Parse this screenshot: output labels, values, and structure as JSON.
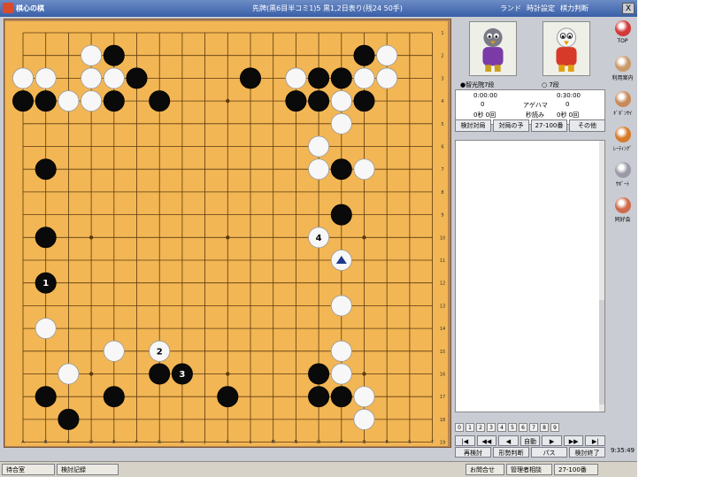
{
  "window": {
    "title": "棋心の棋",
    "game_info": "先牌(黒6目半コミ1)5 黒1,2日表り(残24 50手)",
    "menu": [
      "ランド",
      "時計設定",
      "棋力判断"
    ],
    "close": "X"
  },
  "board": {
    "size": 19,
    "col_labels": [
      "A",
      "B",
      "C",
      "D",
      "E",
      "F",
      "G",
      "H",
      "J",
      "K",
      "L",
      "M",
      "N",
      "O",
      "P",
      "Q",
      "R",
      "S",
      "T"
    ],
    "row_labels": [
      "1",
      "2",
      "3",
      "4",
      "5",
      "6",
      "7",
      "8",
      "9",
      "10",
      "11",
      "12",
      "13",
      "14",
      "15",
      "16",
      "17",
      "18",
      "19"
    ],
    "colors": {
      "wood": "#f2b654",
      "line": "#5c3a10",
      "black_stone": "#0a0a0a",
      "white_stone": "#f7f7f7",
      "marker": "#1d3a8a"
    },
    "stones": [
      {
        "c": "W",
        "col": 4,
        "row": 2
      },
      {
        "c": "B",
        "col": 5,
        "row": 2
      },
      {
        "c": "W",
        "col": 1,
        "row": 3
      },
      {
        "c": "W",
        "col": 2,
        "row": 3
      },
      {
        "c": "W",
        "col": 4,
        "row": 3
      },
      {
        "c": "W",
        "col": 5,
        "row": 3
      },
      {
        "c": "B",
        "col": 6,
        "row": 3
      },
      {
        "c": "B",
        "col": 11,
        "row": 3
      },
      {
        "c": "B",
        "col": 1,
        "row": 4
      },
      {
        "c": "B",
        "col": 2,
        "row": 4
      },
      {
        "c": "W",
        "col": 3,
        "row": 4
      },
      {
        "c": "W",
        "col": 4,
        "row": 4
      },
      {
        "c": "B",
        "col": 5,
        "row": 4
      },
      {
        "c": "B",
        "col": 7,
        "row": 4
      },
      {
        "c": "W",
        "col": 13,
        "row": 3
      },
      {
        "c": "B",
        "col": 14,
        "row": 3
      },
      {
        "c": "B",
        "col": 15,
        "row": 3
      },
      {
        "c": "W",
        "col": 16,
        "row": 3
      },
      {
        "c": "W",
        "col": 17,
        "row": 3
      },
      {
        "c": "B",
        "col": 16,
        "row": 2
      },
      {
        "c": "W",
        "col": 17,
        "row": 2
      },
      {
        "c": "B",
        "col": 13,
        "row": 4
      },
      {
        "c": "B",
        "col": 14,
        "row": 4
      },
      {
        "c": "W",
        "col": 15,
        "row": 4
      },
      {
        "c": "B",
        "col": 16,
        "row": 4
      },
      {
        "c": "W",
        "col": 15,
        "row": 5
      },
      {
        "c": "W",
        "col": 14,
        "row": 6
      },
      {
        "c": "B",
        "col": 2,
        "row": 7
      },
      {
        "c": "W",
        "col": 14,
        "row": 7
      },
      {
        "c": "B",
        "col": 15,
        "row": 7
      },
      {
        "c": "W",
        "col": 16,
        "row": 7
      },
      {
        "c": "B",
        "col": 15,
        "row": 9
      },
      {
        "c": "B",
        "col": 2,
        "row": 10
      },
      {
        "c": "W",
        "col": 14,
        "row": 10,
        "n": "4"
      },
      {
        "c": "W",
        "col": 15,
        "row": 11,
        "mark": true
      },
      {
        "c": "B",
        "col": 2,
        "row": 12,
        "n": "1"
      },
      {
        "c": "W",
        "col": 15,
        "row": 13
      },
      {
        "c": "W",
        "col": 2,
        "row": 14
      },
      {
        "c": "W",
        "col": 5,
        "row": 15
      },
      {
        "c": "W",
        "col": 7,
        "row": 15,
        "n": "2"
      },
      {
        "c": "W",
        "col": 15,
        "row": 15
      },
      {
        "c": "W",
        "col": 3,
        "row": 16
      },
      {
        "c": "B",
        "col": 7,
        "row": 16
      },
      {
        "c": "B",
        "col": 8,
        "row": 16,
        "n": "3"
      },
      {
        "c": "B",
        "col": 14,
        "row": 16
      },
      {
        "c": "W",
        "col": 15,
        "row": 16
      },
      {
        "c": "B",
        "col": 2,
        "row": 17
      },
      {
        "c": "B",
        "col": 5,
        "row": 17
      },
      {
        "c": "B",
        "col": 10,
        "row": 17
      },
      {
        "c": "B",
        "col": 14,
        "row": 17
      },
      {
        "c": "B",
        "col": 15,
        "row": 17
      },
      {
        "c": "W",
        "col": 16,
        "row": 17
      },
      {
        "c": "B",
        "col": 3,
        "row": 18
      },
      {
        "c": "W",
        "col": 16,
        "row": 18
      }
    ]
  },
  "players": {
    "black_name": "●智光院7段",
    "white_name": "○ 7段",
    "black_time": "0:00:00",
    "white_time": "0:30:00",
    "agehama_label": "アゲハマ",
    "black_agehama": "0",
    "white_agehama": "0",
    "black_byoyomi": "0秒 0回",
    "white_byoyomi": "0秒 0回",
    "mid_label": "秒読み"
  },
  "panel_buttons": [
    "検討対局",
    "対局の予",
    "27-100番",
    "その他"
  ],
  "number_row": [
    "0",
    "1",
    "2",
    "3",
    "4",
    "5",
    "6",
    "7",
    "8",
    "9"
  ],
  "controls_1": [
    "|◀",
    "◀◀",
    "◀",
    "自動",
    "▶",
    "▶▶",
    "▶|"
  ],
  "controls_2": [
    "再検討",
    "形勢判断",
    "パス",
    "検討終了"
  ],
  "sidebar": [
    {
      "label": "TOP",
      "color": "#d23a3a"
    },
    {
      "label": "利用案内",
      "color": "#c99a6a"
    },
    {
      "label": "ｷﾞﾎﾞﾝｻｲ",
      "color": "#c88a5a"
    },
    {
      "label": "ﾚｰﾃｨﾝｸﾞ",
      "color": "#d87a2a"
    },
    {
      "label": "ｻﾎﾟｰﾄ",
      "color": "#9a9aa6"
    },
    {
      "label": "同好会",
      "color": "#d06a4a"
    }
  ],
  "taskbar": {
    "items": [
      "待合室",
      "検討記録",
      "お問合せ",
      "管理者相談",
      "27-100番"
    ]
  },
  "clock": "9:35:49"
}
